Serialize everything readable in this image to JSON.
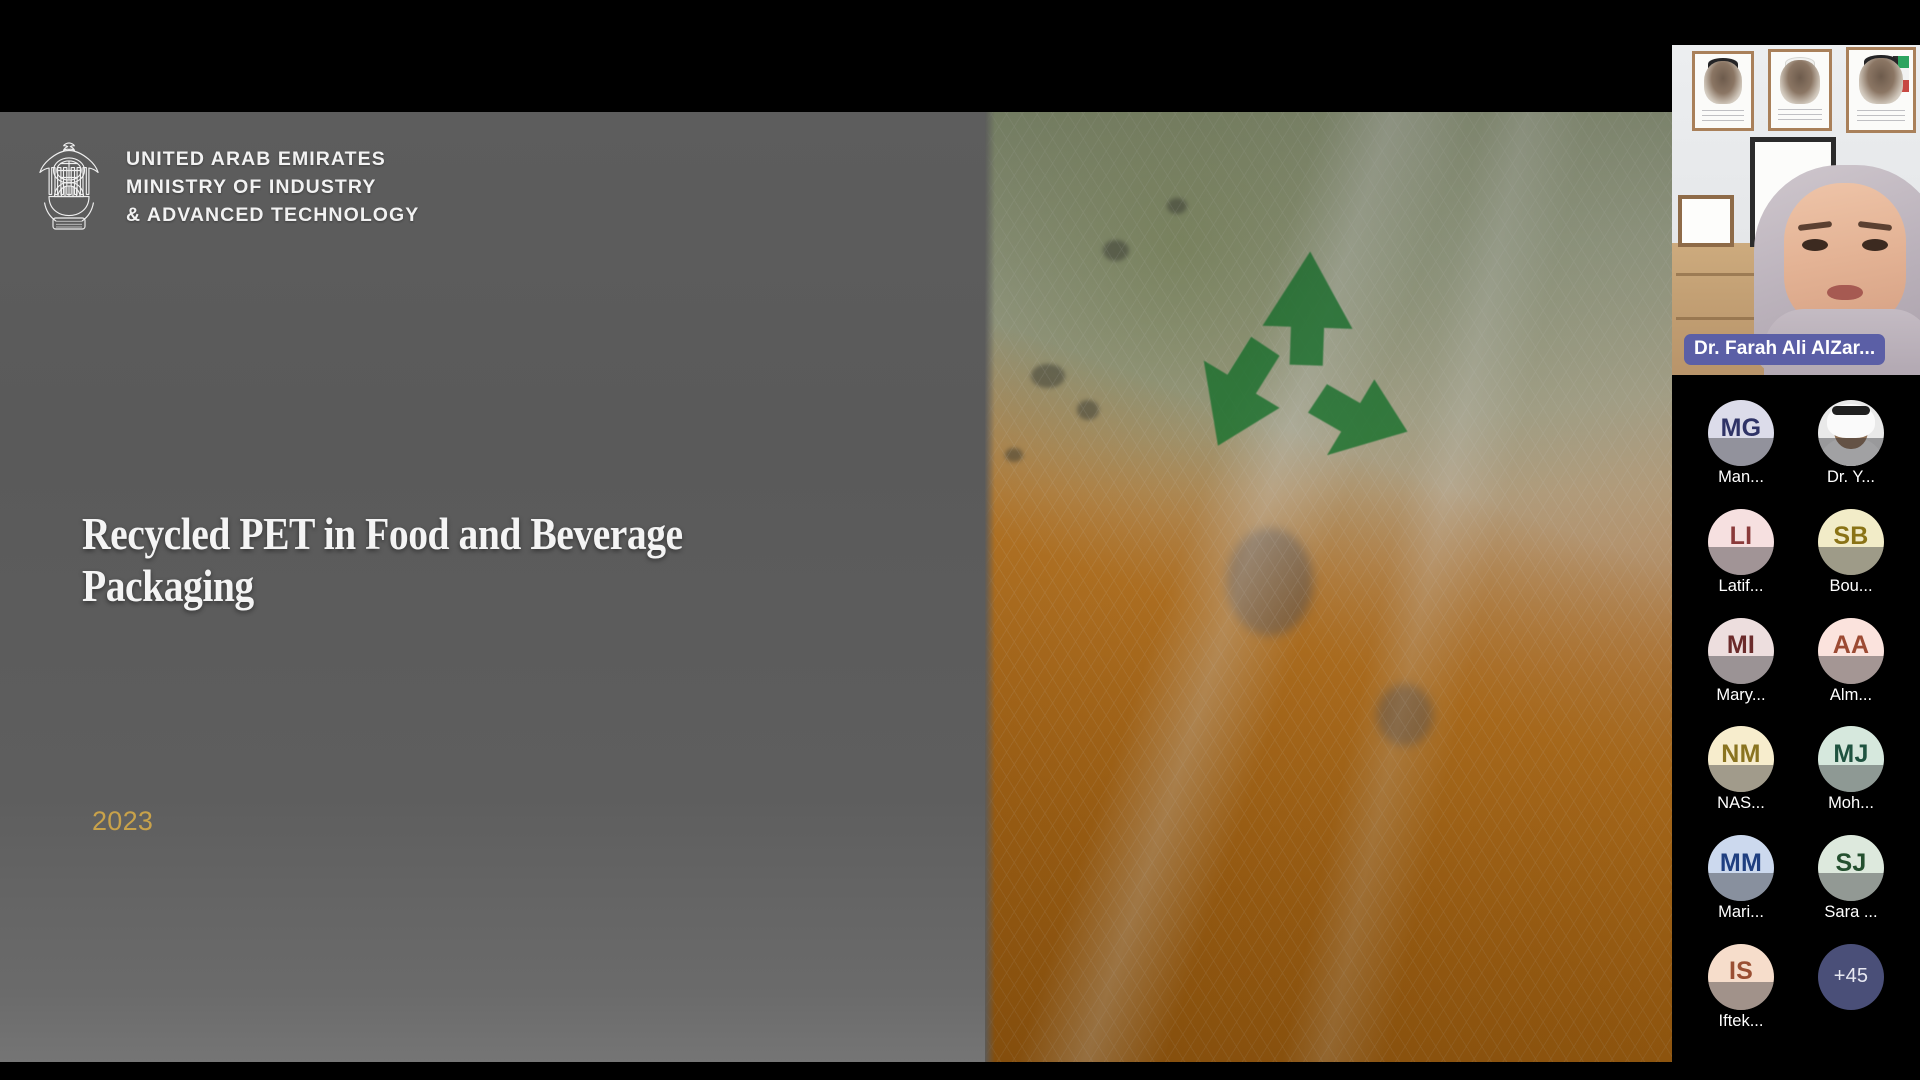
{
  "meeting": {
    "active_speaker": {
      "name": "Dr. Farah Ali AlZar...",
      "avatar_kind": "video"
    },
    "participants": [
      {
        "initials": "MG",
        "name": "Man...",
        "bg": "#dcdcea",
        "fg": "#2f3366",
        "kind": "initials"
      },
      {
        "initials": "",
        "name": "Dr. Y...",
        "bg": "#e9e9e9",
        "fg": "#333333",
        "kind": "photo"
      },
      {
        "initials": "LI",
        "name": "Latif...",
        "bg": "#f6e0e0",
        "fg": "#8a3a3a",
        "kind": "initials"
      },
      {
        "initials": "SB",
        "name": "Bou...",
        "bg": "#f2ecc8",
        "fg": "#8a7316",
        "kind": "initials"
      },
      {
        "initials": "MI",
        "name": "Mary...",
        "bg": "#eddede",
        "fg": "#6b2b2b",
        "kind": "initials"
      },
      {
        "initials": "AA",
        "name": "Alm...",
        "bg": "#fbe3dd",
        "fg": "#9c4a33",
        "kind": "initials"
      },
      {
        "initials": "NM",
        "name": "NAS...",
        "bg": "#f7edcd",
        "fg": "#8a7420",
        "kind": "initials"
      },
      {
        "initials": "MJ",
        "name": "Moh...",
        "bg": "#d6e8dd",
        "fg": "#1f5340",
        "kind": "initials"
      },
      {
        "initials": "MM",
        "name": "Mari...",
        "bg": "#ccd9ee",
        "fg": "#1f3f80",
        "kind": "initials"
      },
      {
        "initials": "SJ",
        "name": "Sara ...",
        "bg": "#dde9dd",
        "fg": "#24502f",
        "kind": "initials"
      },
      {
        "initials": "IS",
        "name": "Iftek...",
        "bg": "#f6ddcb",
        "fg": "#9a4f33",
        "kind": "initials"
      },
      {
        "initials": "+45",
        "name": "",
        "bg": "#4a4f78",
        "fg": "#e8e9f2",
        "kind": "overflow"
      }
    ],
    "overflow_label": "+45"
  },
  "slide": {
    "organization": "UNITED ARAB EMIRATES\nMINISTRY OF INDUSTRY\n& ADVANCED TECHNOLOGY",
    "org_line1": "UNITED ARAB EMIRATES",
    "org_line2": "MINISTRY OF INDUSTRY",
    "org_line3": "& ADVANCED TECHNOLOGY",
    "title": "Recycled PET in Food and Beverage Packaging",
    "year": "2023",
    "emblem_name": "uae-falcon-emblem",
    "photo_subject": "plastic-wrapped produce with recycling symbol"
  },
  "colors": {
    "slide_bg": "#5d5d5d",
    "title_text": "#f4f4f4",
    "year_gold": "#c9a24a",
    "name_badge": "#5b5fa6",
    "rail_bg": "#000000",
    "recycle_green": "#17862f"
  }
}
